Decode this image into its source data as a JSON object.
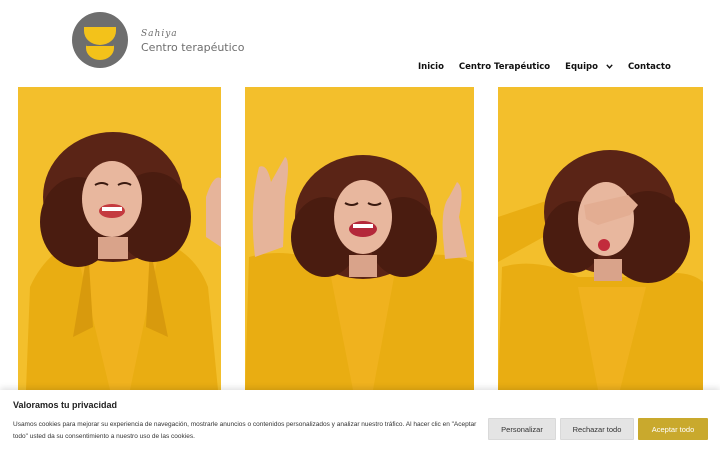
{
  "brand": {
    "script_text": "Sahiya",
    "name": "Centro terapéutico",
    "logo_circle_color": "#6e6e6e",
    "logo_shape_color": "#f3c21a"
  },
  "nav": {
    "items": [
      {
        "label": "Inicio"
      },
      {
        "label": "Centro Terapéutico"
      },
      {
        "label": "Equipo",
        "icon": "chevron-down-icon"
      },
      {
        "label": "Contacto"
      }
    ]
  },
  "gallery": {
    "background_color": "#f3bf2c",
    "photos": [
      {
        "subject": "woman-laughing"
      },
      {
        "subject": "woman-squinting-hands-up"
      },
      {
        "subject": "woman-holding-nose"
      }
    ]
  },
  "cookie_banner": {
    "title": "Valoramos tu privacidad",
    "text": "Usamos cookies para mejorar su experiencia de navegación, mostrarle anuncios o contenidos personalizados y analizar nuestro tráfico. Al hacer clic en \"Aceptar todo\" usted da su consentimiento a nuestro uso de las cookies.",
    "buttons": {
      "customize": "Personalizar",
      "reject": "Rechazar todo",
      "accept": "Aceptar todo"
    },
    "accent_color": "#c9a92d"
  }
}
